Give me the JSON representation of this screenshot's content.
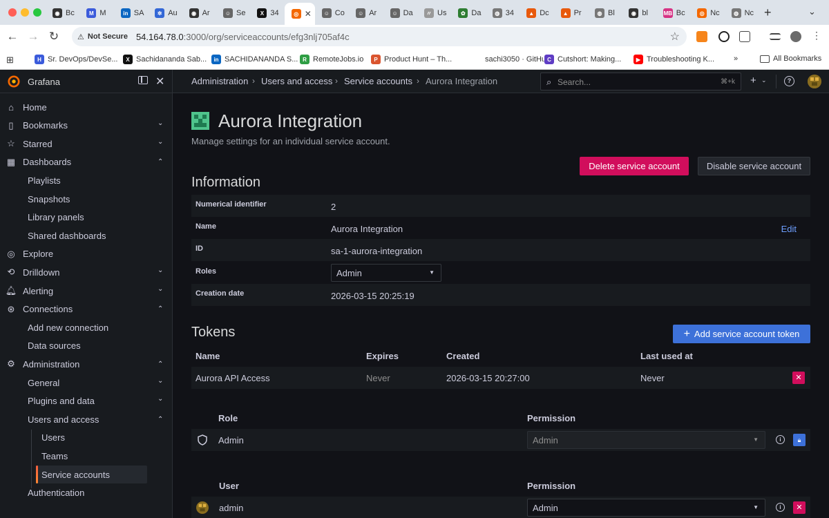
{
  "browser": {
    "tabs": [
      {
        "label": "Bc",
        "icon": "github-icon",
        "color": "#333333"
      },
      {
        "label": "M",
        "icon": "m-icon",
        "color": "#3b5bdb"
      },
      {
        "label": "SA",
        "icon": "linkedin-icon",
        "color": "#0a66c2"
      },
      {
        "label": "Au",
        "icon": "gear-icon",
        "color": "#3367d6"
      },
      {
        "label": "Ar",
        "icon": "github-icon",
        "color": "#333333"
      },
      {
        "label": "Se",
        "icon": "person-icon",
        "color": "#666666"
      },
      {
        "label": "34",
        "icon": "x-icon",
        "color": "#111111"
      },
      {
        "label": "",
        "icon": "grafana-icon",
        "color": "#f46800",
        "active": true
      },
      {
        "label": "Co",
        "icon": "person-icon",
        "color": "#666666"
      },
      {
        "label": "Ar",
        "icon": "person-icon",
        "color": "#666666"
      },
      {
        "label": "Da",
        "icon": "person-icon",
        "color": "#666666"
      },
      {
        "label": "Us",
        "icon": "feather-icon",
        "color": "#999999"
      },
      {
        "label": "Da",
        "icon": "leaf-icon",
        "color": "#2e7d32"
      },
      {
        "label": "34",
        "icon": "globe-icon",
        "color": "#777777"
      },
      {
        "label": "Dc",
        "icon": "brave-icon",
        "color": "#e8590c"
      },
      {
        "label": "Pr",
        "icon": "brave-icon",
        "color": "#e8590c"
      },
      {
        "label": "Bl",
        "icon": "globe-icon",
        "color": "#777777"
      },
      {
        "label": "bl",
        "icon": "github-icon",
        "color": "#333333"
      },
      {
        "label": "Bc",
        "icon": "mb-icon",
        "color": "#d63384"
      },
      {
        "label": "Nc",
        "icon": "grafana-icon",
        "color": "#f46800"
      },
      {
        "label": "Nc",
        "icon": "globe-icon",
        "color": "#777777"
      }
    ],
    "url_host": "54.164.78.0",
    "url_path": ":3000/org/serviceaccounts/efg3nlj705af4c",
    "not_secure": "Not Secure",
    "bookmarks": [
      {
        "label": "Sr. DevOps/DevSe...",
        "icon": "hf-icon",
        "color": "#3b5bdb"
      },
      {
        "label": "Sachidananda Sab...",
        "icon": "x-icon",
        "color": "#111111"
      },
      {
        "label": "SACHIDANANDA S...",
        "icon": "linkedin-icon",
        "color": "#0a66c2"
      },
      {
        "label": "RemoteJobs.io",
        "icon": "remotejobs-icon",
        "color": "#2f9e44"
      },
      {
        "label": "Product Hunt – Th...",
        "icon": "producthunt-icon",
        "color": "#da552f"
      },
      {
        "label": "sachi3050 · GitHub",
        "icon": "github-icon",
        "color": "#ffffff"
      },
      {
        "label": "Cutshort: Making...",
        "icon": "cutshort-icon",
        "color": "#5f3dc4"
      },
      {
        "label": "Troubleshooting K...",
        "icon": "youtube-icon",
        "color": "#ff0000"
      }
    ],
    "all_bookmarks": "All Bookmarks"
  },
  "grafana": {
    "brand": "Grafana",
    "nav": [
      {
        "label": "Home",
        "icon": "home-icon",
        "level": 0
      },
      {
        "label": "Bookmarks",
        "icon": "bookmark-icon",
        "level": 0,
        "chevron": "down"
      },
      {
        "label": "Starred",
        "icon": "star-icon",
        "level": 0,
        "chevron": "down"
      },
      {
        "label": "Dashboards",
        "icon": "apps-icon",
        "level": 0,
        "chevron": "up"
      },
      {
        "label": "Playlists",
        "level": 1
      },
      {
        "label": "Snapshots",
        "level": 1
      },
      {
        "label": "Library panels",
        "level": 1
      },
      {
        "label": "Shared dashboards",
        "level": 1
      },
      {
        "label": "Explore",
        "icon": "compass-icon",
        "level": 0
      },
      {
        "label": "Drilldown",
        "icon": "drilldown-icon",
        "level": 0,
        "chevron": "down"
      },
      {
        "label": "Alerting",
        "icon": "bell-icon",
        "level": 0,
        "chevron": "down"
      },
      {
        "label": "Connections",
        "icon": "connections-icon",
        "level": 0,
        "chevron": "up"
      },
      {
        "label": "Add new connection",
        "level": 1
      },
      {
        "label": "Data sources",
        "level": 1
      },
      {
        "label": "Administration",
        "icon": "cog-icon",
        "level": 0,
        "chevron": "up"
      },
      {
        "label": "General",
        "level": 1,
        "chevron": "down"
      },
      {
        "label": "Plugins and data",
        "level": 1,
        "chevron": "down"
      },
      {
        "label": "Users and access",
        "level": 1,
        "chevron": "up"
      },
      {
        "label": "Users",
        "level": 2
      },
      {
        "label": "Teams",
        "level": 2
      },
      {
        "label": "Service accounts",
        "level": 2,
        "active": true
      },
      {
        "label": "Authentication",
        "level": 1
      }
    ],
    "breadcrumbs": [
      "Administration",
      "Users and access",
      "Service accounts",
      "Aurora Integration"
    ],
    "search_placeholder": "Search...",
    "search_shortcut": "⌘+k",
    "page": {
      "title": "Aurora Integration",
      "subtitle": "Manage settings for an individual service account.",
      "delete_button": "Delete service account",
      "disable_button": "Disable service account",
      "information_title": "Information",
      "info_rows": [
        {
          "label": "Numerical identifier",
          "value": "2"
        },
        {
          "label": "Name",
          "value": "Aurora Integration",
          "action": "Edit"
        },
        {
          "label": "ID",
          "value": "sa-1-aurora-integration"
        },
        {
          "label": "Roles",
          "value": "Admin",
          "select": true
        },
        {
          "label": "Creation date",
          "value": "2026-03-15 20:25:19"
        }
      ],
      "tokens_title": "Tokens",
      "add_token_button": "Add service account token",
      "token_headers": [
        "Name",
        "Expires",
        "Created",
        "Last used at"
      ],
      "tokens": [
        {
          "name": "Aurora API Access",
          "expires": "Never",
          "created": "2026-03-15 20:27:00",
          "last_used": "Never"
        }
      ],
      "role_perm_headers": [
        "Role",
        "Permission"
      ],
      "role_permissions": [
        {
          "role": "Admin",
          "permission": "Admin",
          "locked": true
        }
      ],
      "user_perm_headers": [
        "User",
        "Permission"
      ],
      "user_permissions": [
        {
          "user": "admin",
          "permission": "Admin"
        }
      ]
    }
  }
}
